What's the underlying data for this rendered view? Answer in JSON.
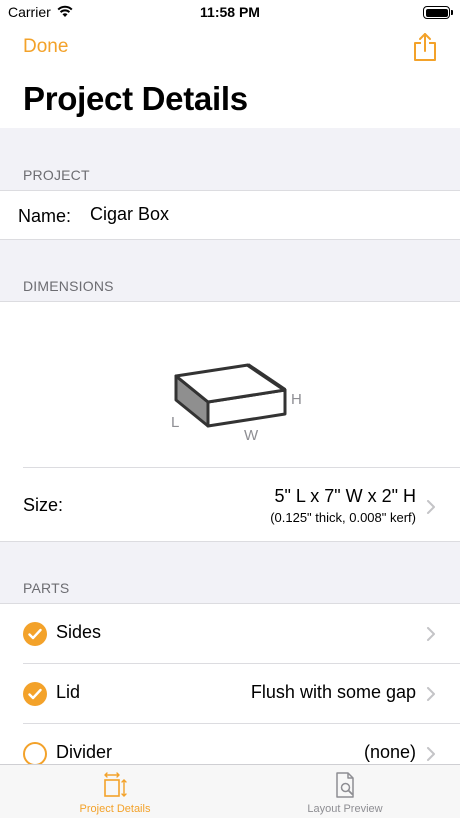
{
  "status": {
    "carrier": "Carrier",
    "time": "11:58 PM"
  },
  "nav": {
    "done_label": "Done",
    "title": "Project Details"
  },
  "project": {
    "header": "PROJECT",
    "name_label": "Name:",
    "name_value": "Cigar Box"
  },
  "dimensions": {
    "header": "DIMENSIONS",
    "illustration_labels": {
      "length": "L",
      "width": "W",
      "height": "H"
    },
    "size_label": "Size:",
    "size_value": "5\" L x 7\" W x 2\" H",
    "size_detail": "(0.125\" thick, 0.008\" kerf)"
  },
  "parts": {
    "header": "PARTS",
    "items": [
      {
        "label": "Sides",
        "value": "",
        "checked": true
      },
      {
        "label": "Lid",
        "value": "Flush with some gap",
        "checked": true
      },
      {
        "label": "Divider",
        "value": "(none)",
        "checked": false
      }
    ]
  },
  "tabs": [
    {
      "label": "Project Details",
      "icon": "project-details-icon",
      "active": true
    },
    {
      "label": "Layout Preview",
      "icon": "layout-preview-icon",
      "active": false
    }
  ],
  "colors": {
    "accent": "#f3a22a",
    "background": "#f2f2f7",
    "secondary_text": "#6d6d72",
    "inactive_tab": "#8e8e93"
  }
}
